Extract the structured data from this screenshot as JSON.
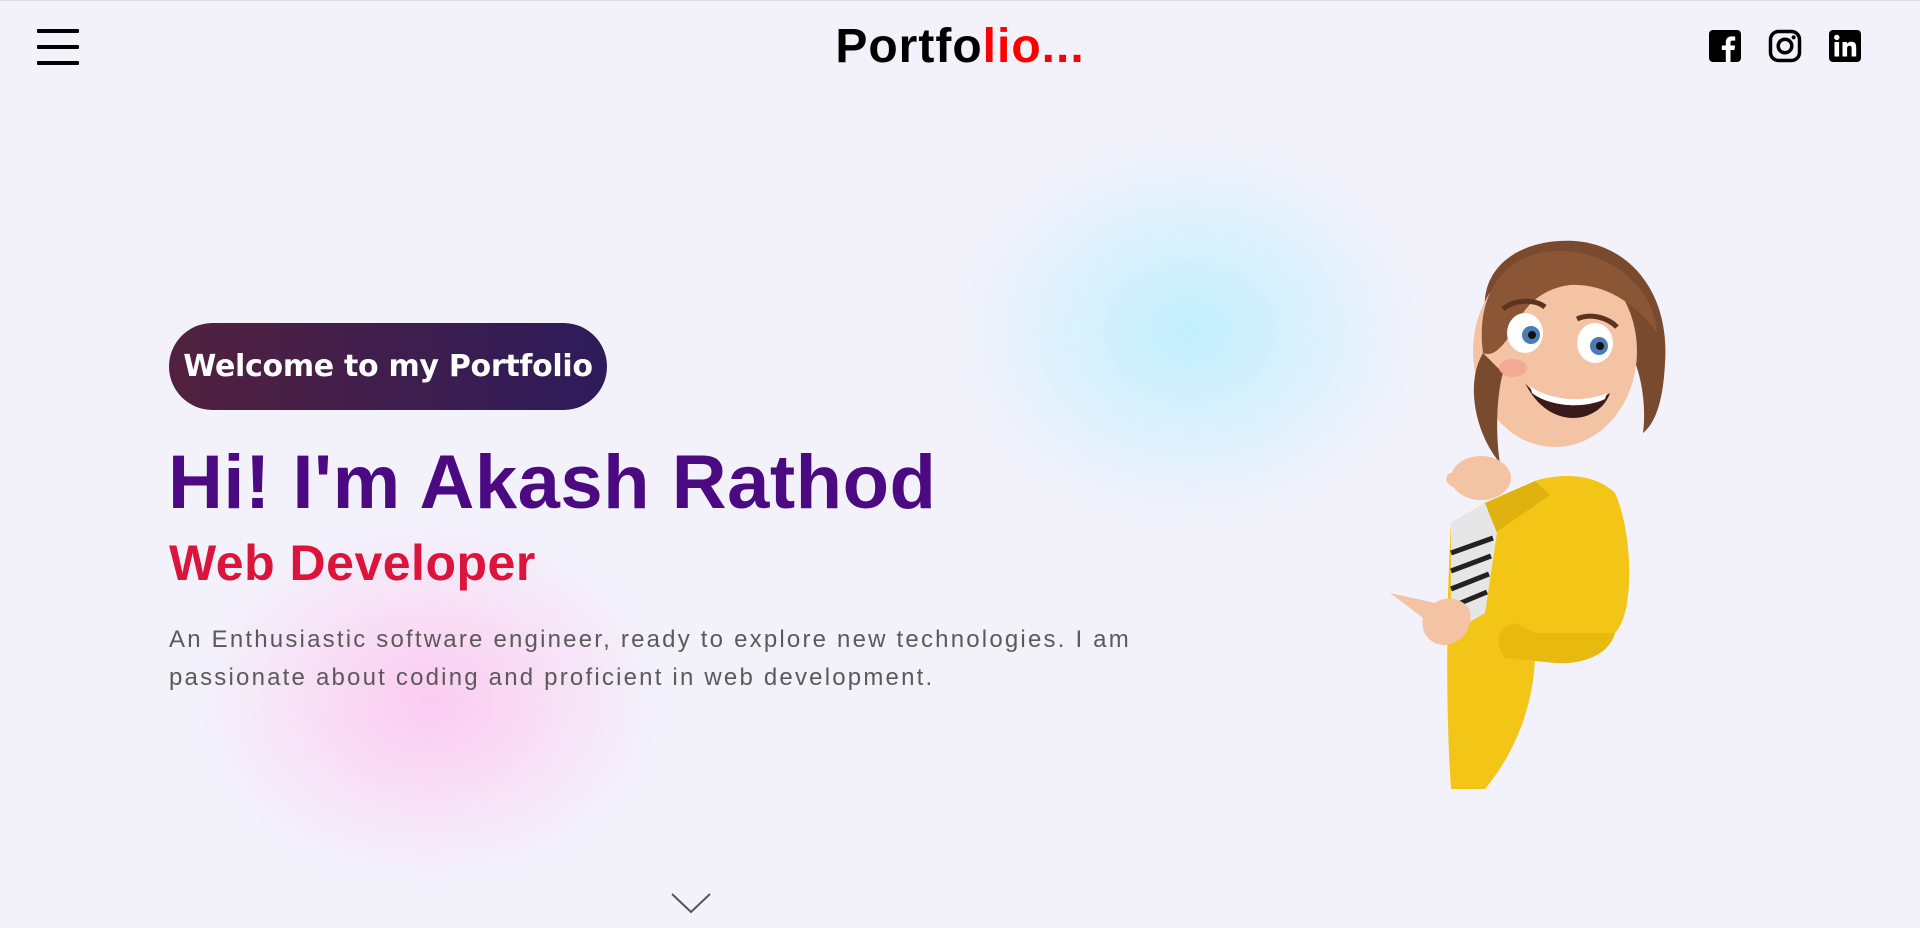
{
  "header": {
    "logo_main": "Portfo",
    "logo_accent": "lio...",
    "social": [
      {
        "icon": "facebook-icon"
      },
      {
        "icon": "instagram-icon"
      },
      {
        "icon": "linkedin-icon"
      }
    ]
  },
  "hero": {
    "badge": "Welcome to my Portfolio",
    "headline": "Hi! I'm Akash Rathod",
    "role": "Web Developer",
    "description": "An Enthusiastic software engineer, ready to explore new technologies. I am passionate about coding and proficient in web development."
  },
  "colors": {
    "headline": "#4b0a82",
    "role": "#dc143c",
    "logo_accent": "#ff0000",
    "badge_start": "#52213f",
    "badge_end": "#2d1b5a"
  }
}
